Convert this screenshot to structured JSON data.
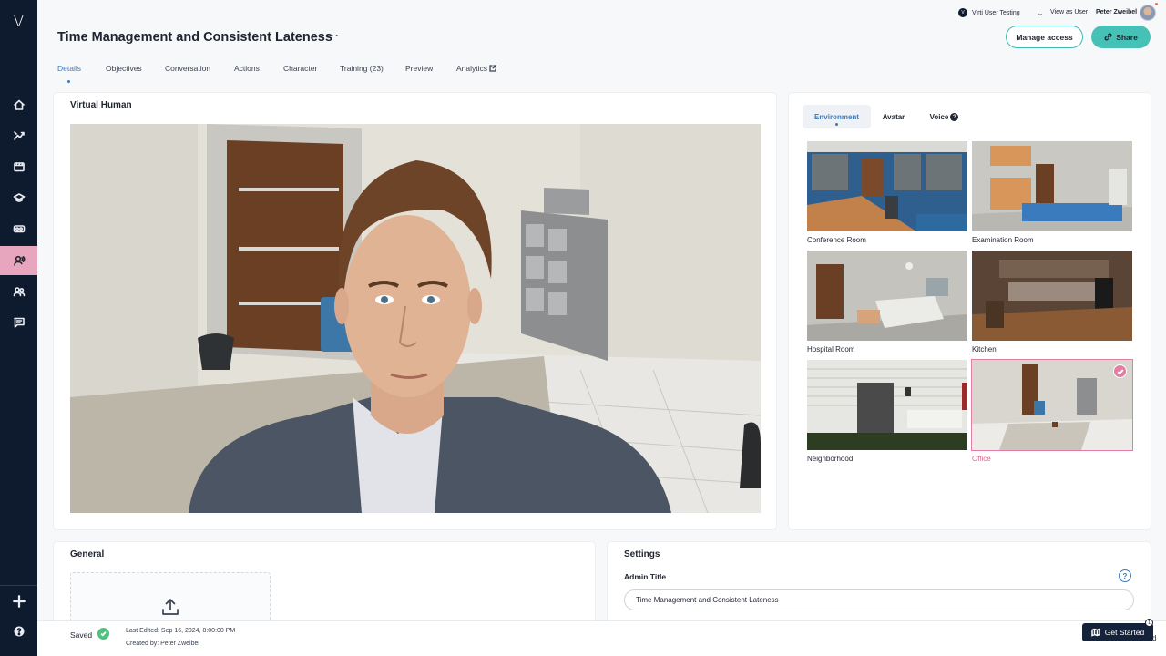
{
  "app": {
    "logo": "V",
    "accent": "#46c1b6",
    "active_tab_color": "#3a7bbf",
    "selected_color": "#e07fa3"
  },
  "sidebar": {
    "items": [
      {
        "icon": "home-icon"
      },
      {
        "icon": "analytics-icon"
      },
      {
        "icon": "film-icon"
      },
      {
        "icon": "graduation-cap-icon"
      },
      {
        "icon": "vr-headset-icon"
      },
      {
        "icon": "virtual-human-icon",
        "active": true
      },
      {
        "icon": "users-icon"
      },
      {
        "icon": "chat-icon"
      },
      {
        "icon": "plus-icon"
      },
      {
        "icon": "help-icon"
      }
    ]
  },
  "header": {
    "org_initial": "V",
    "org_name": "Virti User Testing",
    "view_as": "View as User",
    "user_name": "Peter Zweibel",
    "title": "Time Management and Consistent Lateness",
    "more": "···",
    "manage_access": "Manage access",
    "share": "Share"
  },
  "tabs": [
    {
      "label": "Details",
      "active": true
    },
    {
      "label": "Objectives"
    },
    {
      "label": "Conversation"
    },
    {
      "label": "Actions"
    },
    {
      "label": "Character"
    },
    {
      "label": "Training (23)"
    },
    {
      "label": "Preview"
    },
    {
      "label": "Analytics"
    }
  ],
  "virtual_human": {
    "title": "Virtual Human"
  },
  "environment_panel": {
    "tabs": [
      {
        "label": "Environment",
        "active": true
      },
      {
        "label": "Avatar"
      },
      {
        "label": "Voice",
        "help": "?"
      }
    ],
    "environments": [
      {
        "label": "Conference Room"
      },
      {
        "label": "Examination Room"
      },
      {
        "label": "Hospital Room"
      },
      {
        "label": "Kitchen"
      },
      {
        "label": "Neighborhood"
      },
      {
        "label": "Office",
        "selected": true
      }
    ]
  },
  "general": {
    "title": "General"
  },
  "settings": {
    "title": "Settings",
    "admin_title_label": "Admin Title",
    "admin_help": "?",
    "admin_title_value": "Time Management and Consistent Lateness"
  },
  "footer": {
    "saved": "Saved",
    "last_edited": "Last Edited: Sep 16, 2024, 8:00:00 PM",
    "created_by": "Created by: Peter Zweibel",
    "get_started": "Get Started",
    "get_started_badge": "1",
    "stray_char": "d"
  }
}
